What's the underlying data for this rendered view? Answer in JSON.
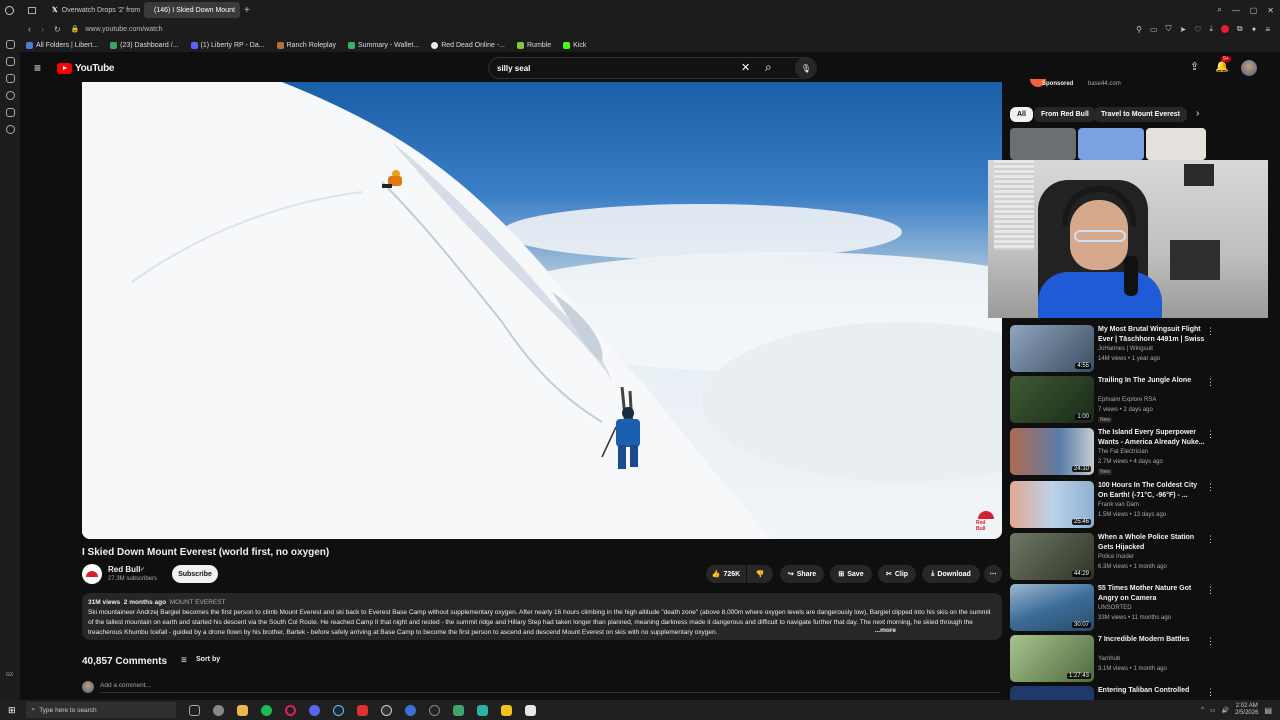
{
  "browser": {
    "tabs": [
      {
        "label": "Overwatch Drops '2' from"
      },
      {
        "label": "(146) I Skied Down Mount"
      }
    ],
    "url": "www.youtube.com/watch",
    "bookmarks": [
      {
        "label": "All Folders | Libert...",
        "color": "#4a7fd6"
      },
      {
        "label": "(23) Dashboard /...",
        "color": "#3ba55d"
      },
      {
        "label": "(1) Liberty RP - Da...",
        "color": "#5865f2"
      },
      {
        "label": "Ranch Roleplay",
        "color": "#b07040"
      },
      {
        "label": "Summary - Wallet...",
        "color": "#38b26a"
      },
      {
        "label": "Red Dead Online -...",
        "color": "#eeeeee"
      },
      {
        "label": "Rumble",
        "color": "#85c742"
      },
      {
        "label": "Kick",
        "color": "#53fc18"
      }
    ]
  },
  "header": {
    "logo_text": "YouTube",
    "search_value": "silly seal",
    "notification_count": "9+"
  },
  "video": {
    "title": "I Skied Down Mount Everest (world first, no oxygen)",
    "channel": "Red Bull",
    "subscribers": "27.3M subscribers",
    "subscribe_label": "Subscribe",
    "likes": "726K",
    "share_label": "Share",
    "save_label": "Save",
    "clip_label": "Clip",
    "download_label": "Download",
    "views": "31M views",
    "age": "2 months ago",
    "tag": "MOUNT EVEREST",
    "description": "Ski mountaineer Andrzej Bargiel becomes the first person to climb Mount Everest and ski back to Everest Base Camp without supplementary oxygen. After nearly 16 hours climbing in the high altitude \"death zone\" (above 8,000m where oxygen levels are dangerously low), Bargiel clipped into his skis on the summit of the tallest mountain on earth and started his descent via the South Col Route. He reached Camp II that night and rested - the summit ridge and Hillary Step had taken longer than planned, meaning darkness made it dangerous and difficult to navigate further that day. The next morning, he skied through the treacherous Khumbu Icefall - guided by a drone flown by his brother, Bartek - before safely arriving at Base Camp to become the first person to ascend and descend Mount Everest on skis with no supplementary oxygen.",
    "more_label": "...more"
  },
  "comments": {
    "count": "40,857 Comments",
    "sort_label": "Sort by",
    "add_placeholder": "Add a comment..."
  },
  "sidebar_ad": {
    "sponsored": "Sponsored",
    "domain": "base44.com"
  },
  "chips": [
    {
      "label": "All"
    },
    {
      "label": "From Red Bull"
    },
    {
      "label": "Travel to Mount Everest"
    }
  ],
  "recommendations": [
    {
      "title": "My Most Brutal Wingsuit Flight Ever | Täschhorn 4491m | Swiss",
      "channel": "JoHannes | Wingsuit",
      "meta": "14M views • 1 year ago",
      "duration": "4:55",
      "badge": "",
      "color": "#5b6f86"
    },
    {
      "title": "Trailing In The Jungle Alone",
      "channel": "Ephraim Explore RSA",
      "meta": "7 views • 2 days ago",
      "duration": "1:00",
      "badge": "New",
      "color": "#2e4a2a"
    },
    {
      "title": "The Island Every Superpower Wants - America Already Nuke...",
      "channel": "The Fat Electrician",
      "meta": "2.7M views • 4 days ago",
      "duration": "24:10",
      "badge": "New",
      "color": "#7a3b2e"
    },
    {
      "title": "100 Hours In The Coldest City On Earth! (-71°C, -96°F) - ...",
      "channel": "Frank van Dam",
      "meta": "1.5M views • 13 days ago",
      "duration": "25:46",
      "badge": "",
      "color": "#9fb9d6"
    },
    {
      "title": "When a Whole Police Station Gets Hijacked",
      "channel": "Police Insider",
      "meta": "6.3M views • 1 month ago",
      "duration": "44:29",
      "badge": "",
      "color": "#4a5244"
    },
    {
      "title": "55 Times Mother Nature Got Angry on Camera",
      "channel": "UNSORTED",
      "meta": "33M views • 11 months ago",
      "duration": "30:07",
      "badge": "",
      "color": "#3d6d9a"
    },
    {
      "title": "7 Incredible Modern Battles",
      "channel": "Yarnhub",
      "meta": "3.1M views • 1 month ago",
      "duration": "1:27:43",
      "badge": "",
      "color": "#6b8a5a"
    },
    {
      "title": "Entering Taliban Controlled",
      "channel": "",
      "meta": "",
      "duration": "",
      "badge": "",
      "color": "#1e3a6a"
    }
  ],
  "taskbar": {
    "search_placeholder": "Type here to search",
    "time": "2:02 AM",
    "date": "2/5/2026"
  }
}
